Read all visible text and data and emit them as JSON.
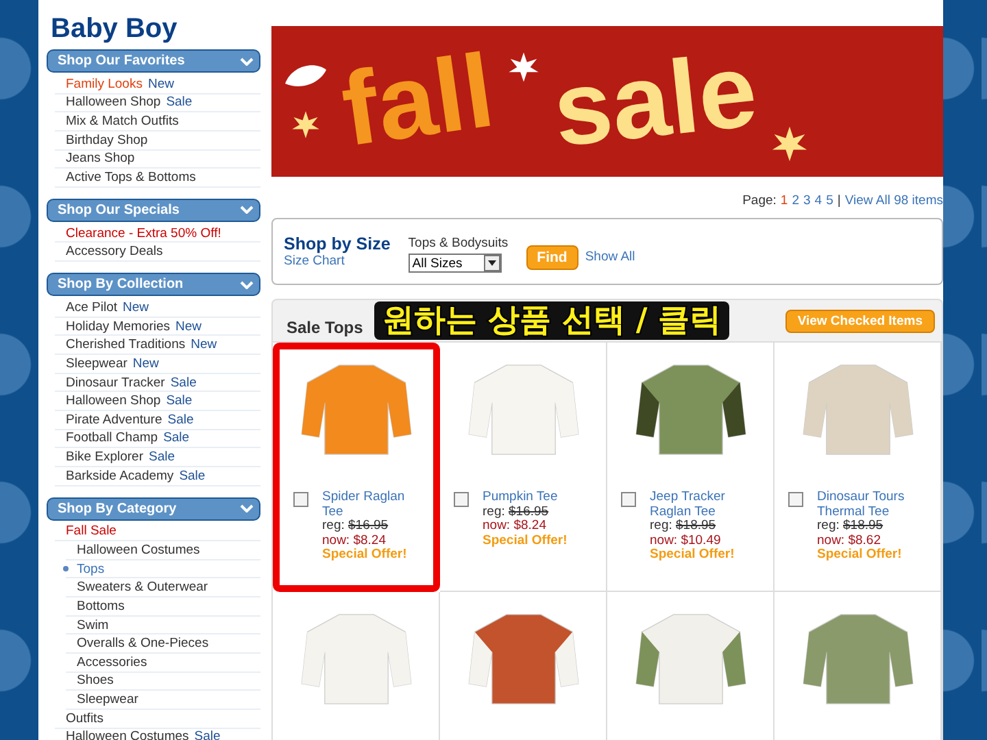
{
  "page_title": "Baby Boy",
  "sidebar": [
    {
      "title": "Shop Our Favorites",
      "items": [
        {
          "label": "Family Looks",
          "badge": "New",
          "color": "#e0400f"
        },
        {
          "label": "Halloween Shop",
          "badge": "Sale"
        },
        {
          "label": "Mix & Match Outfits"
        },
        {
          "label": "Birthday Shop"
        },
        {
          "label": "Jeans Shop"
        },
        {
          "label": "Active Tops & Bottoms"
        }
      ]
    },
    {
      "title": "Shop Our Specials",
      "items": [
        {
          "label": "Clearance - Extra 50% Off!",
          "color": "#cc0000"
        },
        {
          "label": "Accessory Deals"
        }
      ]
    },
    {
      "title": "Shop By Collection",
      "items": [
        {
          "label": "Ace Pilot",
          "badge": "New"
        },
        {
          "label": "Holiday Memories",
          "badge": "New"
        },
        {
          "label": "Cherished Traditions",
          "badge": "New"
        },
        {
          "label": "Sleepwear",
          "badge": "New"
        },
        {
          "label": "Dinosaur Tracker",
          "badge": "Sale"
        },
        {
          "label": "Halloween Shop",
          "badge": "Sale"
        },
        {
          "label": "Pirate Adventure",
          "badge": "Sale"
        },
        {
          "label": "Football Champ",
          "badge": "Sale"
        },
        {
          "label": "Bike Explorer",
          "badge": "Sale"
        },
        {
          "label": "Barkside Academy",
          "badge": "Sale"
        }
      ]
    },
    {
      "title": "Shop By Category",
      "items": [
        {
          "label": "Fall Sale",
          "color": "#cc0000",
          "children": [
            {
              "label": "Halloween Costumes",
              "selected": false
            },
            {
              "label": "Tops",
              "selected": true
            },
            {
              "label": "Sweaters & Outerwear",
              "selected": false
            },
            {
              "label": "Bottoms",
              "selected": false
            },
            {
              "label": "Swim",
              "selected": false
            },
            {
              "label": "Overalls & One-Pieces",
              "selected": false
            },
            {
              "label": "Accessories",
              "selected": false
            },
            {
              "label": "Shoes",
              "selected": false
            },
            {
              "label": "Sleepwear",
              "selected": false
            }
          ]
        },
        {
          "label": "Outfits"
        },
        {
          "label": "Halloween Costumes",
          "badge": "Sale"
        }
      ]
    }
  ],
  "banner": {
    "word_1": "fall",
    "word_2": "sale"
  },
  "pagination": {
    "label": "Page:",
    "pages": [
      {
        "label": "1",
        "selected": true
      },
      {
        "label": "2",
        "selected": false
      },
      {
        "label": "3",
        "selected": false
      },
      {
        "label": "4",
        "selected": false
      },
      {
        "label": "5",
        "selected": false
      }
    ],
    "separator": "|",
    "view_all": "View All 98 items"
  },
  "size_box": {
    "title": "Shop by Size",
    "link": "Size Chart",
    "field_label": "Tops & Bodysuits",
    "select_value": "All Sizes",
    "button": "Find",
    "show_all": "Show All"
  },
  "annotation": "원하는 상품 선택 / 클릭",
  "products_panel": {
    "heading": "Sale Tops",
    "button": "View Checked Items"
  },
  "products": [
    {
      "name": "Spider Raglan Tee",
      "reg_label": "reg:",
      "reg": "$16.95",
      "now": "now: $8.24",
      "offer": "Special Offer!",
      "checked": false,
      "highlighted": true
    },
    {
      "name": "Pumpkin Tee",
      "reg_label": "reg:",
      "reg": "$16.95",
      "now": "now: $8.24",
      "offer": "Special Offer!",
      "checked": false,
      "highlighted": false
    },
    {
      "name": "Jeep Tracker Raglan Tee",
      "reg_label": "reg:",
      "reg": "$18.95",
      "now": "now: $10.49",
      "offer": "Special Offer!",
      "checked": false,
      "highlighted": false
    },
    {
      "name": "Dinosaur Tours Thermal Tee",
      "reg_label": "reg:",
      "reg": "$18.95",
      "now": "now: $8.62",
      "offer": "Special Offer!",
      "checked": false,
      "highlighted": false
    },
    {
      "highlighted": false
    },
    {
      "highlighted": false
    },
    {
      "highlighted": false
    },
    {
      "highlighted": false
    }
  ]
}
